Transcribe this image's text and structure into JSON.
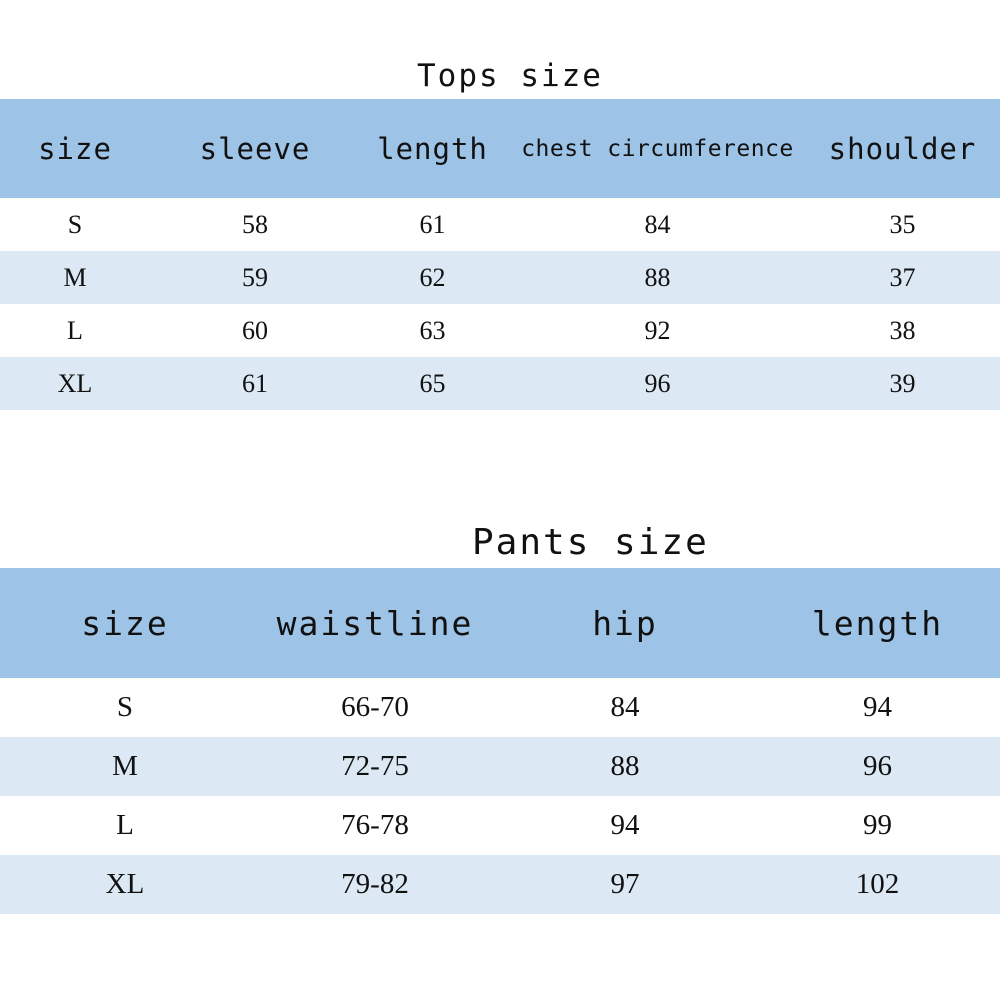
{
  "tops": {
    "title": "Tops size",
    "headers": [
      "size",
      "sleeve",
      "length",
      "chest circumference",
      "shoulder"
    ],
    "rows": [
      [
        "S",
        "58",
        "61",
        "84",
        "35"
      ],
      [
        "M",
        "59",
        "62",
        "88",
        "37"
      ],
      [
        "L",
        "60",
        "63",
        "92",
        "38"
      ],
      [
        "XL",
        "61",
        "65",
        "96",
        "39"
      ]
    ]
  },
  "pants": {
    "title": "Pants size",
    "headers": [
      "size",
      "waistline",
      "hip",
      "length"
    ],
    "rows": [
      [
        "S",
        "66-70",
        "84",
        "94"
      ],
      [
        "M",
        "72-75",
        "88",
        "96"
      ],
      [
        "L",
        "76-78",
        "94",
        "99"
      ],
      [
        "XL",
        "79-82",
        "97",
        "102"
      ]
    ]
  },
  "colors": {
    "header_band": "#9dc3e6",
    "stripe_row": "#dce9f5",
    "plain_row": "#ffffff",
    "text": "#111111"
  }
}
